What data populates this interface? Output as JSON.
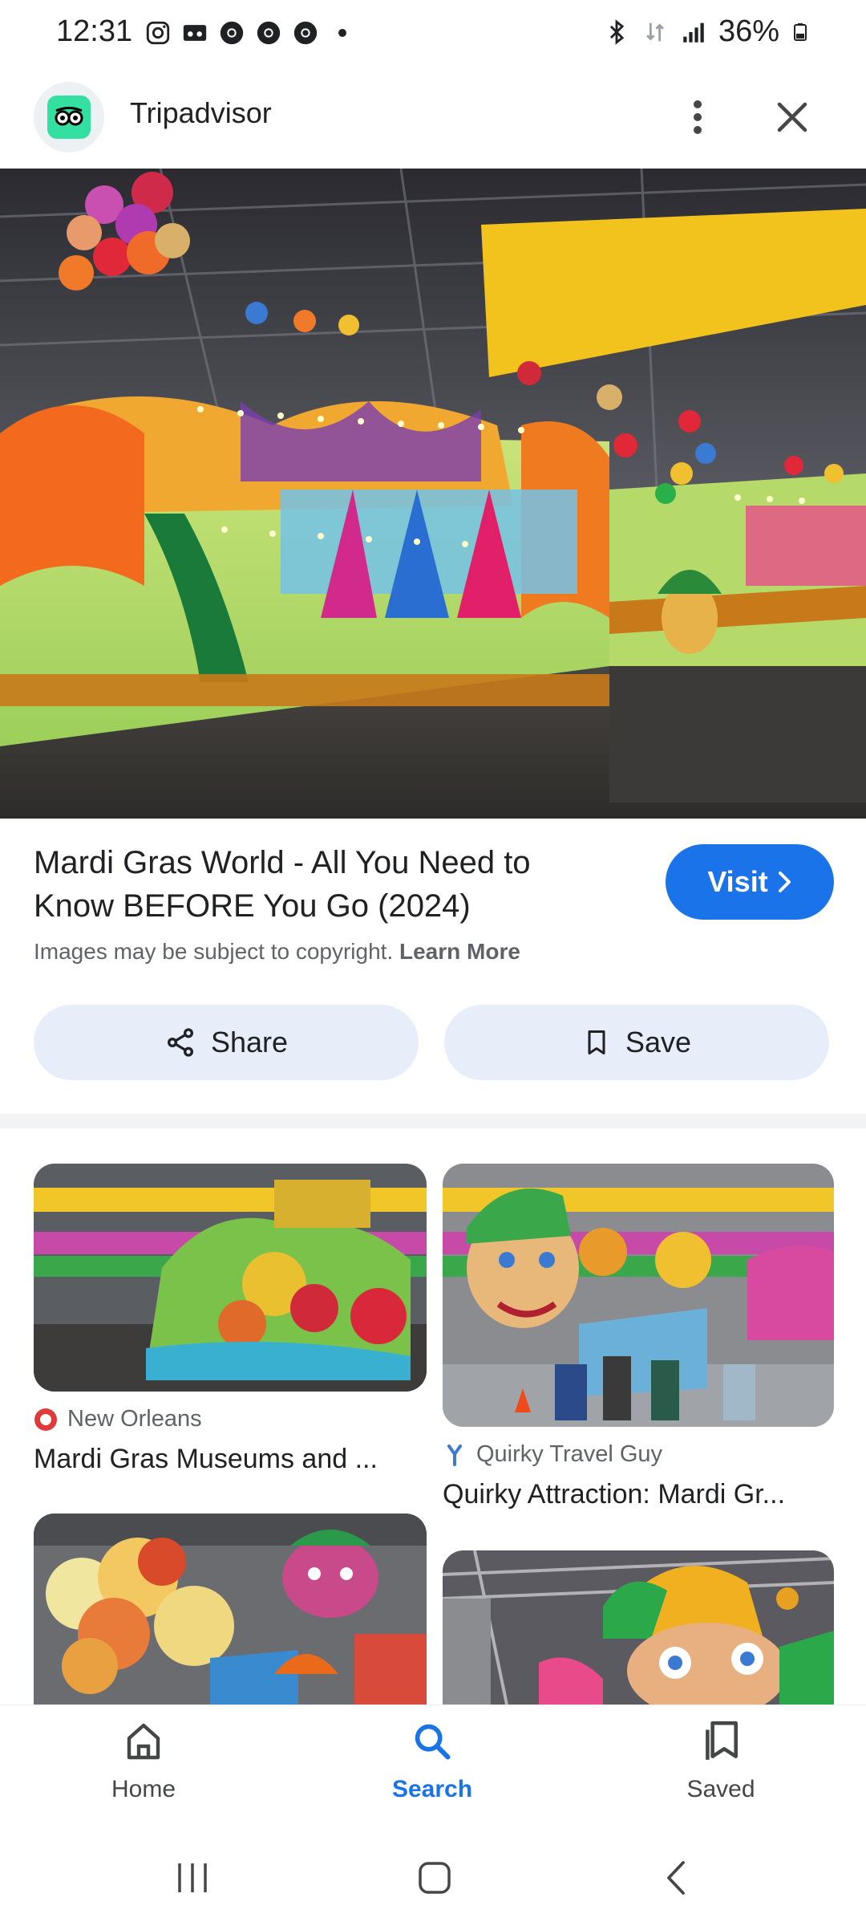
{
  "status_bar": {
    "time": "12:31",
    "battery": "36%",
    "icons_left": [
      "instagram-icon",
      "voicemail-icon",
      "chrome-icon",
      "chrome-icon",
      "chrome-icon",
      "dot-icon"
    ],
    "icons_right": [
      "bluetooth-icon",
      "data-icon",
      "signal-icon",
      "battery-icon"
    ]
  },
  "header": {
    "site_name": "Tripadvisor",
    "brand_color": "#34e0a1"
  },
  "result": {
    "title": "Mardi Gras World - All You Need to Know BEFORE You Go (2024)",
    "visit_label": "Visit",
    "copyright_text": "Images may be subject to copyright.",
    "learn_more": "Learn More",
    "share_label": "Share",
    "save_label": "Save"
  },
  "related": [
    {
      "source": "New Orleans",
      "title": "Mardi Gras Museums and ..."
    },
    {
      "source": "Quirky Travel Guy",
      "title": "Quirky Attraction: Mardi Gr..."
    },
    {
      "source": "",
      "title": ""
    },
    {
      "source": "",
      "title": ""
    }
  ],
  "bottom_nav": {
    "home": "Home",
    "search": "Search",
    "saved": "Saved",
    "active_color": "#1a73e8"
  }
}
